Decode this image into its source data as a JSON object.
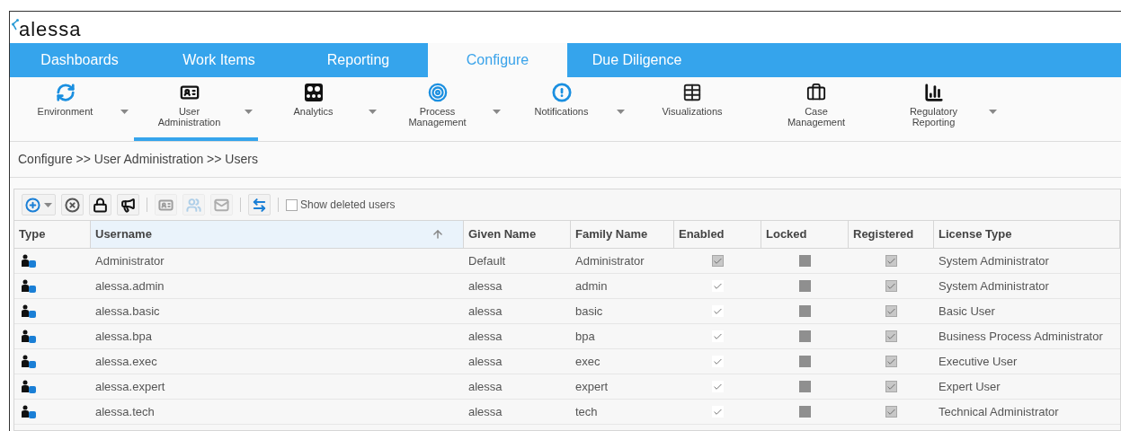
{
  "logo": {
    "text": "alessa"
  },
  "nav_tabs": [
    {
      "label": "Dashboards",
      "selected": false
    },
    {
      "label": "Work Items",
      "selected": false
    },
    {
      "label": "Reporting",
      "selected": false
    },
    {
      "label": "Configure",
      "selected": true
    },
    {
      "label": "Due Diligence",
      "selected": false
    }
  ],
  "sub_nav": [
    {
      "kind": "environment",
      "label": "Environment",
      "dropdown": true,
      "selected": false
    },
    {
      "kind": "user",
      "label": "User Administration",
      "dropdown": true,
      "selected": true
    },
    {
      "kind": "analytics",
      "label": "Analytics",
      "dropdown": true,
      "selected": false
    },
    {
      "kind": "process",
      "label": "Process Management",
      "dropdown": true,
      "selected": false
    },
    {
      "kind": "notifications",
      "label": "Notifications",
      "dropdown": true,
      "selected": false
    },
    {
      "kind": "visualizations",
      "label": "Visualizations",
      "dropdown": false,
      "selected": false
    },
    {
      "kind": "case",
      "label": "Case Management",
      "dropdown": false,
      "selected": false
    },
    {
      "kind": "regulatory",
      "label": "Regulatory Reporting",
      "dropdown": true,
      "selected": false
    }
  ],
  "breadcrumb": "Configure >> User Administration >> Users",
  "toolbar": {
    "groups": [
      [
        {
          "kind": "add",
          "disabled": false
        },
        {
          "kind": "remove",
          "disabled": false
        },
        {
          "kind": "lock",
          "disabled": false
        },
        {
          "kind": "announce",
          "disabled": false
        }
      ],
      [
        {
          "kind": "card",
          "disabled": true
        },
        {
          "kind": "group",
          "disabled": true
        },
        {
          "kind": "mail",
          "disabled": true
        }
      ],
      [
        {
          "kind": "transfer",
          "disabled": false
        }
      ]
    ],
    "show_deleted": {
      "label": "Show deleted users",
      "checked": false
    }
  },
  "table": {
    "columns": [
      {
        "label": "Type",
        "sorted": false
      },
      {
        "label": "Username",
        "sorted": true
      },
      {
        "label": "Given Name",
        "sorted": false
      },
      {
        "label": "Family Name",
        "sorted": false
      },
      {
        "label": "Enabled",
        "sorted": false
      },
      {
        "label": "Locked",
        "sorted": false
      },
      {
        "label": "Registered",
        "sorted": false
      },
      {
        "label": "License Type",
        "sorted": false
      }
    ],
    "rows": [
      {
        "username": "Administrator",
        "given_name": "Default",
        "family_name": "Administrator",
        "enabled": {
          "checked": true,
          "disabled": true
        },
        "locked": {
          "checked": false,
          "disabled": true
        },
        "registered": {
          "checked": true,
          "disabled": true
        },
        "license_type": "System Administrator"
      },
      {
        "username": "alessa.admin",
        "given_name": "alessa",
        "family_name": "admin",
        "enabled": {
          "checked": true,
          "disabled": false
        },
        "locked": {
          "checked": false,
          "disabled": true
        },
        "registered": {
          "checked": true,
          "disabled": true
        },
        "license_type": "System Administrator"
      },
      {
        "username": "alessa.basic",
        "given_name": "alessa",
        "family_name": "basic",
        "enabled": {
          "checked": true,
          "disabled": false
        },
        "locked": {
          "checked": false,
          "disabled": true
        },
        "registered": {
          "checked": true,
          "disabled": true
        },
        "license_type": "Basic User"
      },
      {
        "username": "alessa.bpa",
        "given_name": "alessa",
        "family_name": "bpa",
        "enabled": {
          "checked": true,
          "disabled": false
        },
        "locked": {
          "checked": false,
          "disabled": true
        },
        "registered": {
          "checked": true,
          "disabled": true
        },
        "license_type": "Business Process Administrator"
      },
      {
        "username": "alessa.exec",
        "given_name": "alessa",
        "family_name": "exec",
        "enabled": {
          "checked": true,
          "disabled": false
        },
        "locked": {
          "checked": false,
          "disabled": true
        },
        "registered": {
          "checked": true,
          "disabled": true
        },
        "license_type": "Executive User"
      },
      {
        "username": "alessa.expert",
        "given_name": "alessa",
        "family_name": "expert",
        "enabled": {
          "checked": true,
          "disabled": false
        },
        "locked": {
          "checked": false,
          "disabled": true
        },
        "registered": {
          "checked": true,
          "disabled": true
        },
        "license_type": "Expert User"
      },
      {
        "username": "alessa.tech",
        "given_name": "alessa",
        "family_name": "tech",
        "enabled": {
          "checked": true,
          "disabled": false
        },
        "locked": {
          "checked": false,
          "disabled": true
        },
        "registered": {
          "checked": true,
          "disabled": true
        },
        "license_type": "Technical Administrator"
      }
    ]
  }
}
